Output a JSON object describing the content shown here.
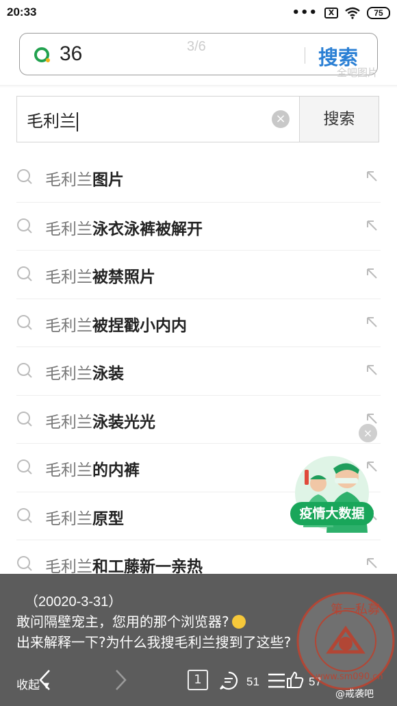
{
  "status": {
    "time": "20:33",
    "sim": "X",
    "battery": "75"
  },
  "browser": {
    "query": "36",
    "page_indicator": "3/6",
    "search_button": "搜索",
    "all_images_link": "全吧图片"
  },
  "inner_search": {
    "value": "毛利兰",
    "button": "搜索"
  },
  "suggestions": [
    {
      "prefix": "毛利兰",
      "rest": "图片"
    },
    {
      "prefix": "毛利兰",
      "rest": "泳衣泳裤被解开"
    },
    {
      "prefix": "毛利兰",
      "rest": "被禁照片"
    },
    {
      "prefix": "毛利兰",
      "rest": "被捏戳小内内"
    },
    {
      "prefix": "毛利兰",
      "rest": "泳装"
    },
    {
      "prefix": "毛利兰",
      "rest": "泳装光光"
    },
    {
      "prefix": "毛利兰",
      "rest": "的内裤"
    },
    {
      "prefix": "毛利兰",
      "rest": "原型"
    },
    {
      "prefix": "毛利兰",
      "rest": "和工藤新一亲热"
    }
  ],
  "badge": {
    "label": "疫情大数据",
    "close": "×"
  },
  "caption": {
    "date": "（20020-3-31）",
    "line1": "敢问隔壁宠主，您用的那个浏览器?",
    "line2": "出来解释一下?为什么我搜毛利兰搜到了这些?"
  },
  "bottom_bar": {
    "collapse": "收起",
    "tabs": "1",
    "comments": "51",
    "likes": "57"
  },
  "watermark": {
    "caption": "@戒袭吧"
  },
  "colors": {
    "accent_blue": "#2a7fd4",
    "badge_green": "#19a65a",
    "overlay": "#464646"
  }
}
